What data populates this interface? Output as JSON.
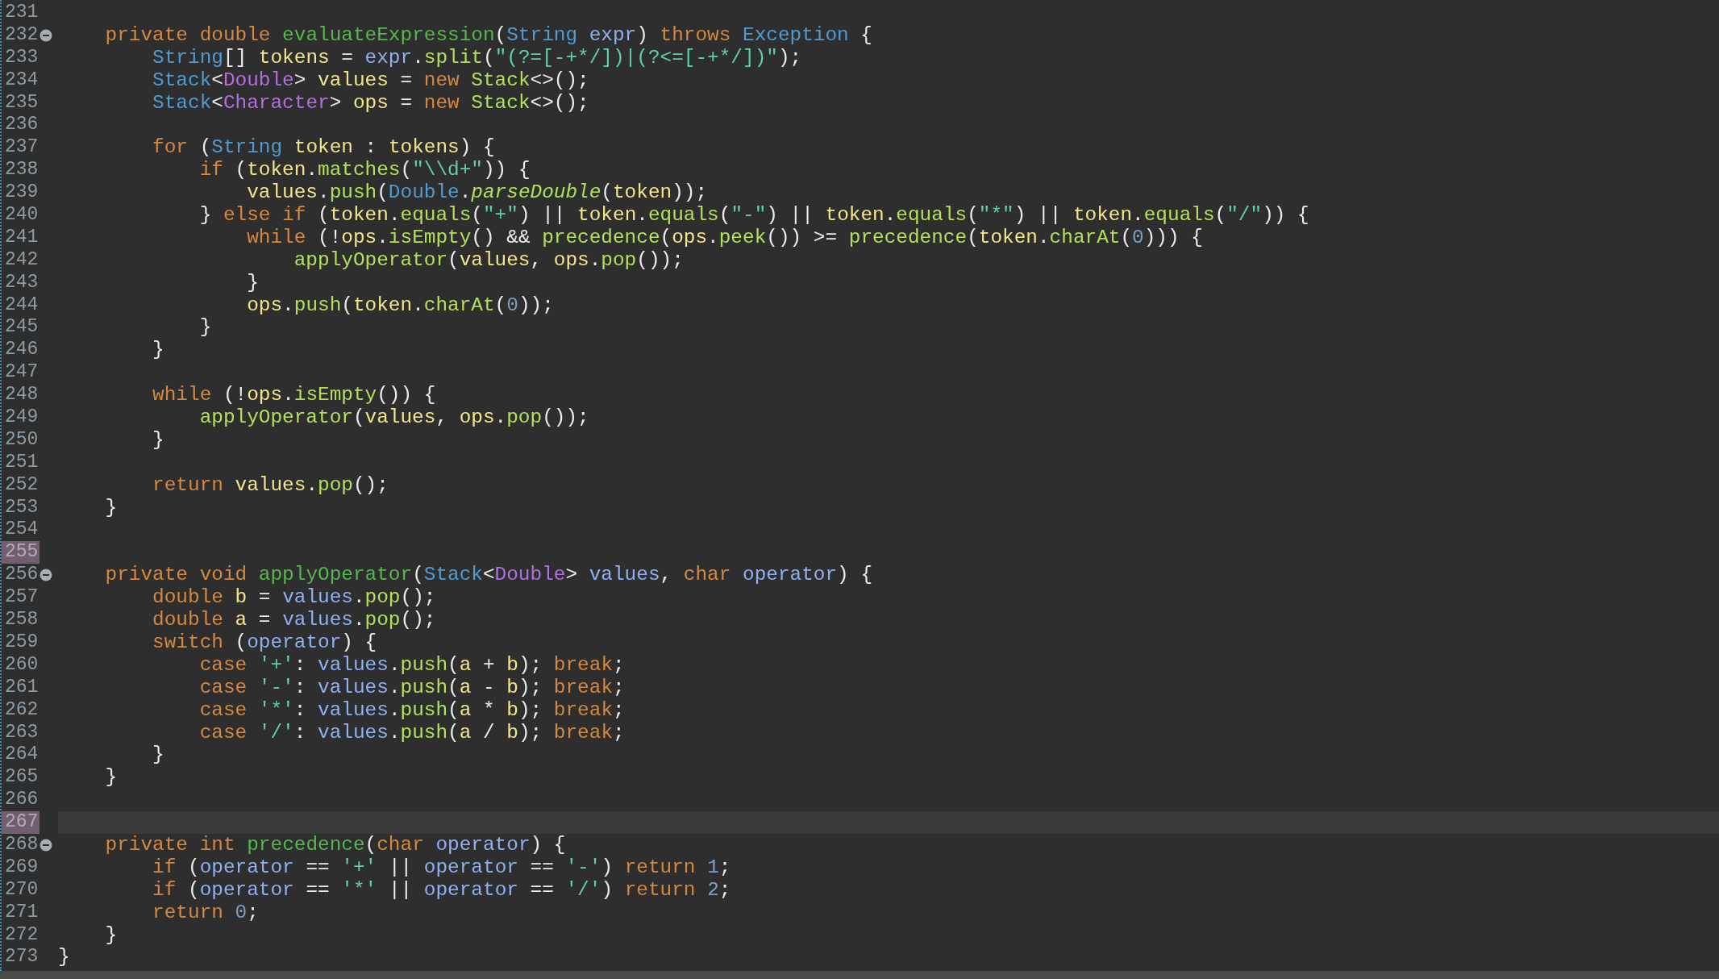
{
  "editor": {
    "lines": [
      {
        "number": "231",
        "fold": false,
        "mark": false,
        "current": false
      },
      {
        "number": "232",
        "fold": true,
        "mark": false,
        "current": false,
        "tokens": [
          {
            "kind": "keyword",
            "text": "    private"
          },
          {
            "kind": "keyword",
            "text": " double"
          },
          {
            "kind": "decl",
            "text": " evaluateExpression"
          },
          {
            "kind": "plain",
            "text": "("
          },
          {
            "kind": "type",
            "text": "String"
          },
          {
            "kind": "param",
            "text": " expr"
          },
          {
            "kind": "plain",
            "text": ") "
          },
          {
            "kind": "keyword",
            "text": "throws"
          },
          {
            "kind": "type",
            "text": " Exception"
          },
          {
            "kind": "plain",
            "text": " {"
          }
        ]
      },
      {
        "number": "233",
        "fold": false,
        "mark": false,
        "current": false,
        "tokens": [
          {
            "kind": "type",
            "text": "        String"
          },
          {
            "kind": "plain",
            "text": "[] "
          },
          {
            "kind": "local",
            "text": "tokens"
          },
          {
            "kind": "plain",
            "text": " = "
          },
          {
            "kind": "param",
            "text": "expr"
          },
          {
            "kind": "plain",
            "text": "."
          },
          {
            "kind": "call",
            "text": "split"
          },
          {
            "kind": "plain",
            "text": "("
          },
          {
            "kind": "string",
            "text": "\"(?=[-+*/])|(?<=[-+*/])\""
          },
          {
            "kind": "plain",
            "text": ");"
          }
        ]
      },
      {
        "number": "234",
        "fold": false,
        "mark": false,
        "current": false,
        "tokens": [
          {
            "kind": "type",
            "text": "        Stack"
          },
          {
            "kind": "plain",
            "text": "<"
          },
          {
            "kind": "generic",
            "text": "Double"
          },
          {
            "kind": "plain",
            "text": "> "
          },
          {
            "kind": "local",
            "text": "values"
          },
          {
            "kind": "plain",
            "text": " = "
          },
          {
            "kind": "keyword",
            "text": "new"
          },
          {
            "kind": "call",
            "text": " Stack"
          },
          {
            "kind": "plain",
            "text": "<>();"
          }
        ]
      },
      {
        "number": "235",
        "fold": false,
        "mark": false,
        "current": false,
        "tokens": [
          {
            "kind": "type",
            "text": "        Stack"
          },
          {
            "kind": "plain",
            "text": "<"
          },
          {
            "kind": "generic",
            "text": "Character"
          },
          {
            "kind": "plain",
            "text": "> "
          },
          {
            "kind": "local",
            "text": "ops"
          },
          {
            "kind": "plain",
            "text": " = "
          },
          {
            "kind": "keyword",
            "text": "new"
          },
          {
            "kind": "call",
            "text": " Stack"
          },
          {
            "kind": "plain",
            "text": "<>();"
          }
        ]
      },
      {
        "number": "236",
        "fold": false,
        "mark": false,
        "current": false
      },
      {
        "number": "237",
        "fold": false,
        "mark": false,
        "current": false,
        "tokens": [
          {
            "kind": "keyword",
            "text": "        for"
          },
          {
            "kind": "plain",
            "text": " ("
          },
          {
            "kind": "type",
            "text": "String"
          },
          {
            "kind": "local",
            "text": " token"
          },
          {
            "kind": "plain",
            "text": " : "
          },
          {
            "kind": "local",
            "text": "tokens"
          },
          {
            "kind": "plain",
            "text": ") {"
          }
        ]
      },
      {
        "number": "238",
        "fold": false,
        "mark": false,
        "current": false,
        "tokens": [
          {
            "kind": "keyword",
            "text": "            if"
          },
          {
            "kind": "plain",
            "text": " ("
          },
          {
            "kind": "local",
            "text": "token"
          },
          {
            "kind": "plain",
            "text": "."
          },
          {
            "kind": "call",
            "text": "matches"
          },
          {
            "kind": "plain",
            "text": "("
          },
          {
            "kind": "string",
            "text": "\"\\\\d+\""
          },
          {
            "kind": "plain",
            "text": ")) {"
          }
        ]
      },
      {
        "number": "239",
        "fold": false,
        "mark": false,
        "current": false,
        "tokens": [
          {
            "kind": "local",
            "text": "                values"
          },
          {
            "kind": "plain",
            "text": "."
          },
          {
            "kind": "call",
            "text": "push"
          },
          {
            "kind": "plain",
            "text": "("
          },
          {
            "kind": "type",
            "text": "Double"
          },
          {
            "kind": "plain",
            "text": "."
          },
          {
            "kind": "static",
            "text": "parseDouble"
          },
          {
            "kind": "plain",
            "text": "("
          },
          {
            "kind": "local",
            "text": "token"
          },
          {
            "kind": "plain",
            "text": "));"
          }
        ]
      },
      {
        "number": "240",
        "fold": false,
        "mark": false,
        "current": false,
        "tokens": [
          {
            "kind": "plain",
            "text": "            } "
          },
          {
            "kind": "keyword",
            "text": "else"
          },
          {
            "kind": "keyword",
            "text": " if"
          },
          {
            "kind": "plain",
            "text": " ("
          },
          {
            "kind": "local",
            "text": "token"
          },
          {
            "kind": "plain",
            "text": "."
          },
          {
            "kind": "call",
            "text": "equals"
          },
          {
            "kind": "plain",
            "text": "("
          },
          {
            "kind": "string",
            "text": "\"+\""
          },
          {
            "kind": "plain",
            "text": ") || "
          },
          {
            "kind": "local",
            "text": "token"
          },
          {
            "kind": "plain",
            "text": "."
          },
          {
            "kind": "call",
            "text": "equals"
          },
          {
            "kind": "plain",
            "text": "("
          },
          {
            "kind": "string",
            "text": "\"-\""
          },
          {
            "kind": "plain",
            "text": ") || "
          },
          {
            "kind": "local",
            "text": "token"
          },
          {
            "kind": "plain",
            "text": "."
          },
          {
            "kind": "call",
            "text": "equals"
          },
          {
            "kind": "plain",
            "text": "("
          },
          {
            "kind": "string",
            "text": "\"*\""
          },
          {
            "kind": "plain",
            "text": ") || "
          },
          {
            "kind": "local",
            "text": "token"
          },
          {
            "kind": "plain",
            "text": "."
          },
          {
            "kind": "call",
            "text": "equals"
          },
          {
            "kind": "plain",
            "text": "("
          },
          {
            "kind": "string",
            "text": "\"/\""
          },
          {
            "kind": "plain",
            "text": ")) {"
          }
        ]
      },
      {
        "number": "241",
        "fold": false,
        "mark": false,
        "current": false,
        "tokens": [
          {
            "kind": "keyword",
            "text": "                while"
          },
          {
            "kind": "plain",
            "text": " (!"
          },
          {
            "kind": "local",
            "text": "ops"
          },
          {
            "kind": "plain",
            "text": "."
          },
          {
            "kind": "call",
            "text": "isEmpty"
          },
          {
            "kind": "plain",
            "text": "() && "
          },
          {
            "kind": "call",
            "text": "precedence"
          },
          {
            "kind": "plain",
            "text": "("
          },
          {
            "kind": "local",
            "text": "ops"
          },
          {
            "kind": "plain",
            "text": "."
          },
          {
            "kind": "call",
            "text": "peek"
          },
          {
            "kind": "plain",
            "text": "()) >= "
          },
          {
            "kind": "call",
            "text": "precedence"
          },
          {
            "kind": "plain",
            "text": "("
          },
          {
            "kind": "local",
            "text": "token"
          },
          {
            "kind": "plain",
            "text": "."
          },
          {
            "kind": "call",
            "text": "charAt"
          },
          {
            "kind": "plain",
            "text": "("
          },
          {
            "kind": "number",
            "text": "0"
          },
          {
            "kind": "plain",
            "text": "))) {"
          }
        ]
      },
      {
        "number": "242",
        "fold": false,
        "mark": false,
        "current": false,
        "tokens": [
          {
            "kind": "call",
            "text": "                    applyOperator"
          },
          {
            "kind": "plain",
            "text": "("
          },
          {
            "kind": "local",
            "text": "values"
          },
          {
            "kind": "plain",
            "text": ", "
          },
          {
            "kind": "local",
            "text": "ops"
          },
          {
            "kind": "plain",
            "text": "."
          },
          {
            "kind": "call",
            "text": "pop"
          },
          {
            "kind": "plain",
            "text": "());"
          }
        ]
      },
      {
        "number": "243",
        "fold": false,
        "mark": false,
        "current": false,
        "tokens": [
          {
            "kind": "plain",
            "text": "                }"
          }
        ]
      },
      {
        "number": "244",
        "fold": false,
        "mark": false,
        "current": false,
        "tokens": [
          {
            "kind": "local",
            "text": "                ops"
          },
          {
            "kind": "plain",
            "text": "."
          },
          {
            "kind": "call",
            "text": "push"
          },
          {
            "kind": "plain",
            "text": "("
          },
          {
            "kind": "local",
            "text": "token"
          },
          {
            "kind": "plain",
            "text": "."
          },
          {
            "kind": "call",
            "text": "charAt"
          },
          {
            "kind": "plain",
            "text": "("
          },
          {
            "kind": "number",
            "text": "0"
          },
          {
            "kind": "plain",
            "text": "));"
          }
        ]
      },
      {
        "number": "245",
        "fold": false,
        "mark": false,
        "current": false,
        "tokens": [
          {
            "kind": "plain",
            "text": "            }"
          }
        ]
      },
      {
        "number": "246",
        "fold": false,
        "mark": false,
        "current": false,
        "tokens": [
          {
            "kind": "plain",
            "text": "        }"
          }
        ]
      },
      {
        "number": "247",
        "fold": false,
        "mark": false,
        "current": false
      },
      {
        "number": "248",
        "fold": false,
        "mark": false,
        "current": false,
        "tokens": [
          {
            "kind": "keyword",
            "text": "        while"
          },
          {
            "kind": "plain",
            "text": " (!"
          },
          {
            "kind": "local",
            "text": "ops"
          },
          {
            "kind": "plain",
            "text": "."
          },
          {
            "kind": "call",
            "text": "isEmpty"
          },
          {
            "kind": "plain",
            "text": "()) {"
          }
        ]
      },
      {
        "number": "249",
        "fold": false,
        "mark": false,
        "current": false,
        "tokens": [
          {
            "kind": "call",
            "text": "            applyOperator"
          },
          {
            "kind": "plain",
            "text": "("
          },
          {
            "kind": "local",
            "text": "values"
          },
          {
            "kind": "plain",
            "text": ", "
          },
          {
            "kind": "local",
            "text": "ops"
          },
          {
            "kind": "plain",
            "text": "."
          },
          {
            "kind": "call",
            "text": "pop"
          },
          {
            "kind": "plain",
            "text": "());"
          }
        ]
      },
      {
        "number": "250",
        "fold": false,
        "mark": false,
        "current": false,
        "tokens": [
          {
            "kind": "plain",
            "text": "        }"
          }
        ]
      },
      {
        "number": "251",
        "fold": false,
        "mark": false,
        "current": false
      },
      {
        "number": "252",
        "fold": false,
        "mark": false,
        "current": false,
        "tokens": [
          {
            "kind": "keyword",
            "text": "        return"
          },
          {
            "kind": "local",
            "text": " values"
          },
          {
            "kind": "plain",
            "text": "."
          },
          {
            "kind": "call",
            "text": "pop"
          },
          {
            "kind": "plain",
            "text": "();"
          }
        ]
      },
      {
        "number": "253",
        "fold": false,
        "mark": false,
        "current": false,
        "tokens": [
          {
            "kind": "plain",
            "text": "    }"
          }
        ]
      },
      {
        "number": "254",
        "fold": false,
        "mark": false,
        "current": false
      },
      {
        "number": "255",
        "fold": false,
        "mark": true,
        "current": false
      },
      {
        "number": "256",
        "fold": true,
        "mark": false,
        "current": false,
        "tokens": [
          {
            "kind": "keyword",
            "text": "    private"
          },
          {
            "kind": "keyword",
            "text": " void"
          },
          {
            "kind": "decl",
            "text": " applyOperator"
          },
          {
            "kind": "plain",
            "text": "("
          },
          {
            "kind": "type",
            "text": "Stack"
          },
          {
            "kind": "plain",
            "text": "<"
          },
          {
            "kind": "generic",
            "text": "Double"
          },
          {
            "kind": "plain",
            "text": "> "
          },
          {
            "kind": "param",
            "text": "values"
          },
          {
            "kind": "plain",
            "text": ", "
          },
          {
            "kind": "keyword",
            "text": "char"
          },
          {
            "kind": "param",
            "text": " operator"
          },
          {
            "kind": "plain",
            "text": ") {"
          }
        ]
      },
      {
        "number": "257",
        "fold": false,
        "mark": false,
        "current": false,
        "tokens": [
          {
            "kind": "keyword",
            "text": "        double"
          },
          {
            "kind": "local",
            "text": " b"
          },
          {
            "kind": "plain",
            "text": " = "
          },
          {
            "kind": "param",
            "text": "values"
          },
          {
            "kind": "plain",
            "text": "."
          },
          {
            "kind": "call",
            "text": "pop"
          },
          {
            "kind": "plain",
            "text": "();"
          }
        ]
      },
      {
        "number": "258",
        "fold": false,
        "mark": false,
        "current": false,
        "tokens": [
          {
            "kind": "keyword",
            "text": "        double"
          },
          {
            "kind": "local",
            "text": " a"
          },
          {
            "kind": "plain",
            "text": " = "
          },
          {
            "kind": "param",
            "text": "values"
          },
          {
            "kind": "plain",
            "text": "."
          },
          {
            "kind": "call",
            "text": "pop"
          },
          {
            "kind": "plain",
            "text": "();"
          }
        ]
      },
      {
        "number": "259",
        "fold": false,
        "mark": false,
        "current": false,
        "tokens": [
          {
            "kind": "keyword",
            "text": "        switch"
          },
          {
            "kind": "plain",
            "text": " ("
          },
          {
            "kind": "param",
            "text": "operator"
          },
          {
            "kind": "plain",
            "text": ") {"
          }
        ]
      },
      {
        "number": "260",
        "fold": false,
        "mark": false,
        "current": false,
        "tokens": [
          {
            "kind": "keyword",
            "text": "            case"
          },
          {
            "kind": "string",
            "text": " '+'"
          },
          {
            "kind": "plain",
            "text": ": "
          },
          {
            "kind": "param",
            "text": "values"
          },
          {
            "kind": "plain",
            "text": "."
          },
          {
            "kind": "call",
            "text": "push"
          },
          {
            "kind": "plain",
            "text": "("
          },
          {
            "kind": "local",
            "text": "a"
          },
          {
            "kind": "plain",
            "text": " + "
          },
          {
            "kind": "local",
            "text": "b"
          },
          {
            "kind": "plain",
            "text": "); "
          },
          {
            "kind": "keyword",
            "text": "break"
          },
          {
            "kind": "plain",
            "text": ";"
          }
        ]
      },
      {
        "number": "261",
        "fold": false,
        "mark": false,
        "current": false,
        "tokens": [
          {
            "kind": "keyword",
            "text": "            case"
          },
          {
            "kind": "string",
            "text": " '-'"
          },
          {
            "kind": "plain",
            "text": ": "
          },
          {
            "kind": "param",
            "text": "values"
          },
          {
            "kind": "plain",
            "text": "."
          },
          {
            "kind": "call",
            "text": "push"
          },
          {
            "kind": "plain",
            "text": "("
          },
          {
            "kind": "local",
            "text": "a"
          },
          {
            "kind": "plain",
            "text": " - "
          },
          {
            "kind": "local",
            "text": "b"
          },
          {
            "kind": "plain",
            "text": "); "
          },
          {
            "kind": "keyword",
            "text": "break"
          },
          {
            "kind": "plain",
            "text": ";"
          }
        ]
      },
      {
        "number": "262",
        "fold": false,
        "mark": false,
        "current": false,
        "tokens": [
          {
            "kind": "keyword",
            "text": "            case"
          },
          {
            "kind": "string",
            "text": " '*'"
          },
          {
            "kind": "plain",
            "text": ": "
          },
          {
            "kind": "param",
            "text": "values"
          },
          {
            "kind": "plain",
            "text": "."
          },
          {
            "kind": "call",
            "text": "push"
          },
          {
            "kind": "plain",
            "text": "("
          },
          {
            "kind": "local",
            "text": "a"
          },
          {
            "kind": "plain",
            "text": " * "
          },
          {
            "kind": "local",
            "text": "b"
          },
          {
            "kind": "plain",
            "text": "); "
          },
          {
            "kind": "keyword",
            "text": "break"
          },
          {
            "kind": "plain",
            "text": ";"
          }
        ]
      },
      {
        "number": "263",
        "fold": false,
        "mark": false,
        "current": false,
        "tokens": [
          {
            "kind": "keyword",
            "text": "            case"
          },
          {
            "kind": "string",
            "text": " '/'"
          },
          {
            "kind": "plain",
            "text": ": "
          },
          {
            "kind": "param",
            "text": "values"
          },
          {
            "kind": "plain",
            "text": "."
          },
          {
            "kind": "call",
            "text": "push"
          },
          {
            "kind": "plain",
            "text": "("
          },
          {
            "kind": "local",
            "text": "a"
          },
          {
            "kind": "plain",
            "text": " / "
          },
          {
            "kind": "local",
            "text": "b"
          },
          {
            "kind": "plain",
            "text": "); "
          },
          {
            "kind": "keyword",
            "text": "break"
          },
          {
            "kind": "plain",
            "text": ";"
          }
        ]
      },
      {
        "number": "264",
        "fold": false,
        "mark": false,
        "current": false,
        "tokens": [
          {
            "kind": "plain",
            "text": "        }"
          }
        ]
      },
      {
        "number": "265",
        "fold": false,
        "mark": false,
        "current": false,
        "tokens": [
          {
            "kind": "plain",
            "text": "    }"
          }
        ]
      },
      {
        "number": "266",
        "fold": false,
        "mark": false,
        "current": false
      },
      {
        "number": "267",
        "fold": false,
        "mark": true,
        "current": true
      },
      {
        "number": "268",
        "fold": true,
        "mark": false,
        "current": false,
        "tokens": [
          {
            "kind": "keyword",
            "text": "    private"
          },
          {
            "kind": "keyword",
            "text": " int"
          },
          {
            "kind": "decl",
            "text": " precedence"
          },
          {
            "kind": "plain",
            "text": "("
          },
          {
            "kind": "keyword",
            "text": "char"
          },
          {
            "kind": "param",
            "text": " operator"
          },
          {
            "kind": "plain",
            "text": ") {"
          }
        ]
      },
      {
        "number": "269",
        "fold": false,
        "mark": false,
        "current": false,
        "tokens": [
          {
            "kind": "keyword",
            "text": "        if"
          },
          {
            "kind": "plain",
            "text": " ("
          },
          {
            "kind": "param",
            "text": "operator"
          },
          {
            "kind": "plain",
            "text": " == "
          },
          {
            "kind": "string",
            "text": "'+'"
          },
          {
            "kind": "plain",
            "text": " || "
          },
          {
            "kind": "param",
            "text": "operator"
          },
          {
            "kind": "plain",
            "text": " == "
          },
          {
            "kind": "string",
            "text": "'-'"
          },
          {
            "kind": "plain",
            "text": ") "
          },
          {
            "kind": "keyword",
            "text": "return"
          },
          {
            "kind": "number",
            "text": " 1"
          },
          {
            "kind": "plain",
            "text": ";"
          }
        ]
      },
      {
        "number": "270",
        "fold": false,
        "mark": false,
        "current": false,
        "tokens": [
          {
            "kind": "keyword",
            "text": "        if"
          },
          {
            "kind": "plain",
            "text": " ("
          },
          {
            "kind": "param",
            "text": "operator"
          },
          {
            "kind": "plain",
            "text": " == "
          },
          {
            "kind": "string",
            "text": "'*'"
          },
          {
            "kind": "plain",
            "text": " || "
          },
          {
            "kind": "param",
            "text": "operator"
          },
          {
            "kind": "plain",
            "text": " == "
          },
          {
            "kind": "string",
            "text": "'/'"
          },
          {
            "kind": "plain",
            "text": ") "
          },
          {
            "kind": "keyword",
            "text": "return"
          },
          {
            "kind": "number",
            "text": " 2"
          },
          {
            "kind": "plain",
            "text": ";"
          }
        ]
      },
      {
        "number": "271",
        "fold": false,
        "mark": false,
        "current": false,
        "tokens": [
          {
            "kind": "keyword",
            "text": "        return"
          },
          {
            "kind": "number",
            "text": " 0"
          },
          {
            "kind": "plain",
            "text": ";"
          }
        ]
      },
      {
        "number": "272",
        "fold": false,
        "mark": false,
        "current": false,
        "tokens": [
          {
            "kind": "plain",
            "text": "    }"
          }
        ]
      },
      {
        "number": "273",
        "fold": false,
        "mark": false,
        "current": false,
        "tokens": [
          {
            "kind": "plain",
            "text": "}"
          }
        ]
      }
    ]
  }
}
